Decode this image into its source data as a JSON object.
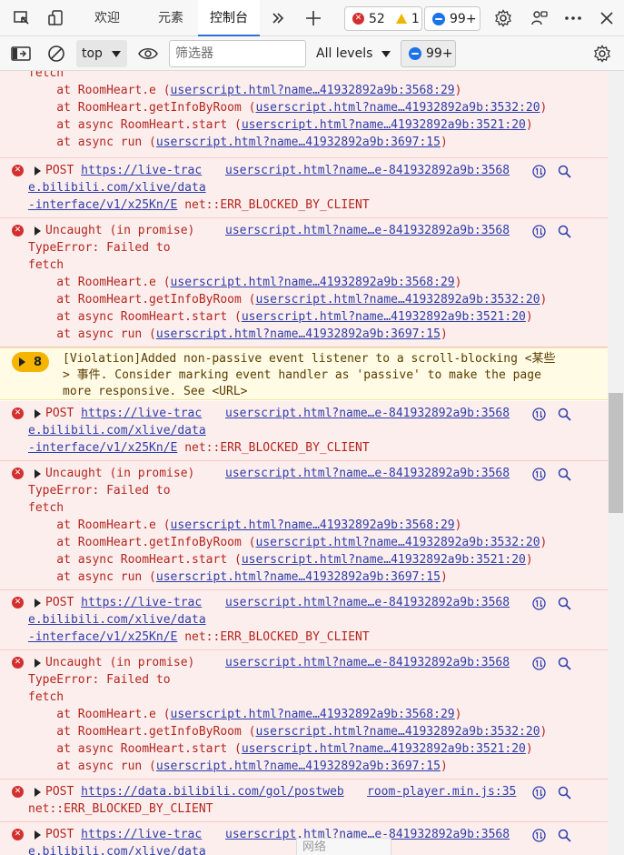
{
  "tabbar": {
    "tabs": [
      {
        "label": "欢迎"
      },
      {
        "label": "元素"
      },
      {
        "label": "控制台"
      }
    ],
    "error_count": "52",
    "warning_count": "1",
    "issues_count": "99+"
  },
  "toolbar": {
    "context": "top",
    "filter_placeholder": "筛选器",
    "levels": "All levels",
    "issues_count": "99+"
  },
  "messages": [
    {
      "type": "stack-tail",
      "lines": [
        {
          "text": "fetch"
        },
        {
          "prefix": "    at RoomHeart.e (",
          "link": "userscript.html?name…41932892a9b:3568:29",
          "suffix": ")"
        },
        {
          "prefix": "    at RoomHeart.getInfoByRoom (",
          "link": "userscript.html?name…41932892a9b:3532:20",
          "suffix": ")"
        },
        {
          "prefix": "    at async RoomHeart.start (",
          "link": "userscript.html?name…41932892a9b:3521:20",
          "suffix": ")"
        },
        {
          "prefix": "    at async run (",
          "link": "userscript.html?name…41932892a9b:3697:15",
          "suffix": ")"
        }
      ]
    },
    {
      "type": "post",
      "method": "POST",
      "url1": "https://live-trac",
      "url2": "e.bilibili.com/xlive/data",
      "url3": "-interface/v1/x25Kn/E",
      "status": "net::ERR_BLOCKED_BY_CLIENT",
      "source": "userscript.html?name…e-841932892a9b:3568"
    },
    {
      "type": "uncaught",
      "title": "Uncaught (in promise)",
      "l2": "TypeError: Failed to",
      "l3": "fetch",
      "source": "userscript.html?name…e-841932892a9b:3568",
      "stack": [
        {
          "prefix": "    at RoomHeart.e (",
          "link": "userscript.html?name…41932892a9b:3568:29",
          "suffix": ")"
        },
        {
          "prefix": "    at RoomHeart.getInfoByRoom (",
          "link": "userscript.html?name…41932892a9b:3532:20",
          "suffix": ")"
        },
        {
          "prefix": "    at async RoomHeart.start (",
          "link": "userscript.html?name…41932892a9b:3521:20",
          "suffix": ")"
        },
        {
          "prefix": "    at async run (",
          "link": "userscript.html?name…41932892a9b:3697:15",
          "suffix": ")"
        }
      ]
    },
    {
      "type": "violation",
      "count": "8",
      "text": "[Violation]Added non-passive event listener to a scroll-blocking <某些\n> 事件. Consider marking event handler as 'passive' to make the page\nmore responsive. See <URL>"
    },
    {
      "type": "post",
      "method": "POST",
      "url1": "https://live-trac",
      "url2": "e.bilibili.com/xlive/data",
      "url3": "-interface/v1/x25Kn/E",
      "status": "net::ERR_BLOCKED_BY_CLIENT",
      "source": "userscript.html?name…e-841932892a9b:3568"
    },
    {
      "type": "uncaught",
      "title": "Uncaught (in promise)",
      "l2": "TypeError: Failed to",
      "l3": "fetch",
      "source": "userscript.html?name…e-841932892a9b:3568",
      "stack": [
        {
          "prefix": "    at RoomHeart.e (",
          "link": "userscript.html?name…41932892a9b:3568:29",
          "suffix": ")"
        },
        {
          "prefix": "    at RoomHeart.getInfoByRoom (",
          "link": "userscript.html?name…41932892a9b:3532:20",
          "suffix": ")"
        },
        {
          "prefix": "    at async RoomHeart.start (",
          "link": "userscript.html?name…41932892a9b:3521:20",
          "suffix": ")"
        },
        {
          "prefix": "    at async run (",
          "link": "userscript.html?name…41932892a9b:3697:15",
          "suffix": ")"
        }
      ]
    },
    {
      "type": "post",
      "method": "POST",
      "url1": "https://live-trac",
      "url2": "e.bilibili.com/xlive/data",
      "url3": "-interface/v1/x25Kn/E",
      "status": "net::ERR_BLOCKED_BY_CLIENT",
      "source": "userscript.html?name…e-841932892a9b:3568"
    },
    {
      "type": "uncaught",
      "title": "Uncaught (in promise)",
      "l2": "TypeError: Failed to",
      "l3": "fetch",
      "source": "userscript.html?name…e-841932892a9b:3568",
      "stack": [
        {
          "prefix": "    at RoomHeart.e (",
          "link": "userscript.html?name…41932892a9b:3568:29",
          "suffix": ")"
        },
        {
          "prefix": "    at RoomHeart.getInfoByRoom (",
          "link": "userscript.html?name…41932892a9b:3532:20",
          "suffix": ")"
        },
        {
          "prefix": "    at async RoomHeart.start (",
          "link": "userscript.html?name…41932892a9b:3521:20",
          "suffix": ")"
        },
        {
          "prefix": "    at async run (",
          "link": "userscript.html?name…41932892a9b:3697:15",
          "suffix": ")"
        }
      ]
    },
    {
      "type": "post-short",
      "method": "POST",
      "url": "https://data.bilibili.com/gol/postweb",
      "source": "room-player.min.js:35",
      "status": "net::ERR_BLOCKED_BY_CLIENT"
    },
    {
      "type": "post",
      "method": "POST",
      "url1": "https://live-trac",
      "url2": "e.bilibili.com/xlive/data",
      "url3": "",
      "status": "",
      "source": "userscript.html?name…e-841932892a9b:3568"
    }
  ],
  "drawer": {
    "label": "网络"
  },
  "colors": {
    "error": "#b3261e",
    "error_bg": "#fdeeee",
    "link": "#2d3ea8",
    "warn_bg": "#fffbe5",
    "warn_badge": "#f5b400",
    "accent": "#2f6fd1"
  }
}
